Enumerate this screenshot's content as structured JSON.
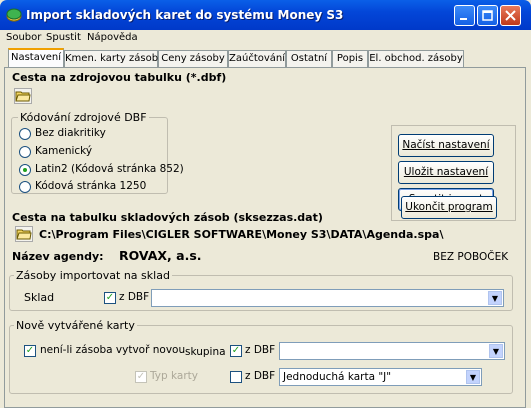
{
  "window": {
    "title": "Import skladových karet do systému Money S3",
    "icon": "money-app-icon"
  },
  "menu": [
    "Soubor",
    "Spustit",
    "Nápověda"
  ],
  "tabs": [
    {
      "label": "Nastavení",
      "active": true
    },
    {
      "label": "Kmen. karty zásoby"
    },
    {
      "label": "Ceny zásoby"
    },
    {
      "label": "Zaúčtování"
    },
    {
      "label": "Ostatní"
    },
    {
      "label": "Popis"
    },
    {
      "label": "El. obchod. zásoby"
    }
  ],
  "source": {
    "heading": "Cesta na zdrojovou tabulku (*.dbf)",
    "encoding_group_title": "Kódování zdrojové DBF",
    "encoding_options": [
      {
        "label": "Bez diakritiky",
        "checked": false
      },
      {
        "label": "Kamenický",
        "checked": false
      },
      {
        "label": "Latin2 (Kódová stránka 852)",
        "checked": true
      },
      {
        "label": "Kódová stránka 1250",
        "checked": false
      }
    ]
  },
  "buttons": {
    "load": "Načíst nastavení",
    "save": "Uložit nastavení",
    "run": "Spustit import",
    "exit": "Ukončit program"
  },
  "stock_table": {
    "heading": "Cesta na tabulku skladových zásob (sksezzas.dat)",
    "path": "C:\\Program Files\\CIGLER SOFTWARE\\Money S3\\DATA\\Agenda.spa\\"
  },
  "agenda": {
    "label": "Název agendy:",
    "name": "ROVAX, a.s.",
    "branch_mode": "BEZ POBOČEK"
  },
  "import_to_store": {
    "group_title": "Zásoby importovat na sklad",
    "store_label": "Sklad",
    "from_dbf_label": "z DBF",
    "from_dbf_checked": true,
    "value": ""
  },
  "new_cards": {
    "group_title": "Nově vytvářené karty",
    "create_if_missing_label": "není-li zásoba vytvoř novou",
    "create_if_missing_checked": true,
    "group_label": "skupina",
    "group_from_dbf_label": "z DBF",
    "group_from_dbf_checked": true,
    "group_value": "",
    "card_type_label": "Typ karty",
    "card_type_checked": true,
    "card_type_from_dbf_label": "z DBF",
    "card_type_from_dbf_checked": false,
    "card_type_value": "Jednoduchá karta \"J\""
  }
}
